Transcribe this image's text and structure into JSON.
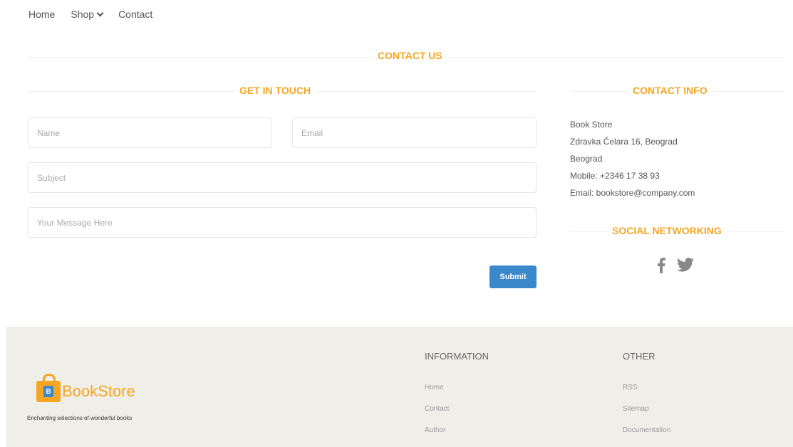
{
  "nav": {
    "home": "Home",
    "shop": "Shop",
    "contact": "Contact"
  },
  "page_title": "CONTACT US",
  "get_in_touch": {
    "title": "GET IN TOUCH",
    "name_placeholder": "Name",
    "email_placeholder": "Email",
    "subject_placeholder": "Subject",
    "message_placeholder": "Your Message Here",
    "submit_label": "Submit"
  },
  "contact_info": {
    "title": "CONTACT INFO",
    "lines": [
      "Book Store",
      "Zdravka Čelara 16, Beograd",
      "Beograd",
      "Mobile: +2346 17 38 93",
      "Email: bookstore@company.com"
    ]
  },
  "social": {
    "title": "SOCIAL NETWORKING",
    "icons": [
      "facebook-icon",
      "twitter-icon"
    ]
  },
  "footer": {
    "logo_letter": "B",
    "logo_text": "BookStore",
    "tagline": "Enchanting selections of wonderful books",
    "information": {
      "title": "INFORMATION",
      "links": [
        "Home",
        "Contact",
        "Author"
      ]
    },
    "other": {
      "title": "OTHER",
      "links": [
        "RSS",
        "Sitemap",
        "Documentation"
      ]
    }
  },
  "colors": {
    "accent": "#f5a623",
    "button": "#3a87c9",
    "footer_bg": "#efeee9"
  }
}
